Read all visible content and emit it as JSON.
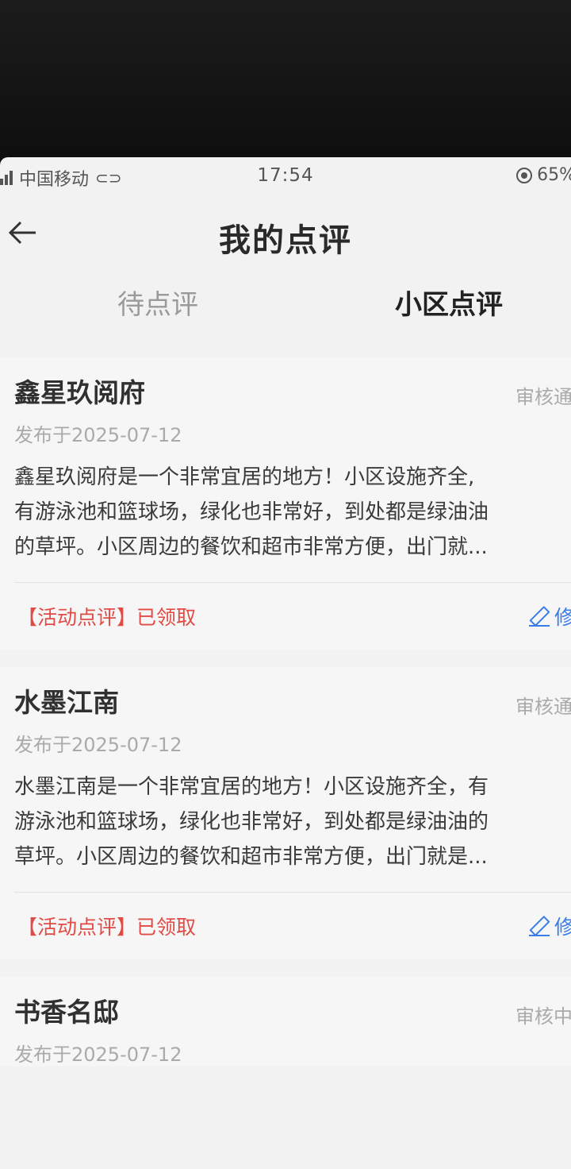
{
  "status_bar": {
    "carrier": "中国移动",
    "time": "17:54",
    "battery": "65%"
  },
  "header": {
    "back_icon": "arrow-left-icon",
    "title": "我的点评"
  },
  "tabs": [
    {
      "label": "待点评",
      "active": false
    },
    {
      "label": "小区点评",
      "active": true
    }
  ],
  "reviews": [
    {
      "name": "鑫星玖阅府",
      "status": "审核通",
      "date": "发布于2025-07-12",
      "lines": [
        "鑫星玖阅府是一个非常宜居的地方！小区设施齐全,",
        "有游泳池和篮球场，绿化也非常好，到处都是绿油油",
        "的草坪。小区周边的餐饮和超市非常方便，出门就..."
      ],
      "tag": "【活动点评】已领取",
      "edit_label": "修"
    },
    {
      "name": "水墨江南",
      "status": "审核通",
      "date": "发布于2025-07-12",
      "lines": [
        "水墨江南是一个非常宜居的地方！小区设施齐全，有",
        "游泳池和篮球场，绿化也非常好，到处都是绿油油的",
        "草坪。小区周边的餐饮和超市非常方便，出门就是..."
      ],
      "tag": "【活动点评】已领取",
      "edit_label": "修"
    },
    {
      "name": "书香名邸",
      "status": "审核中",
      "date": "发布于2025-07-12"
    }
  ],
  "colors": {
    "tag_red": "#e24b45",
    "edit_blue": "#3b7de8"
  }
}
